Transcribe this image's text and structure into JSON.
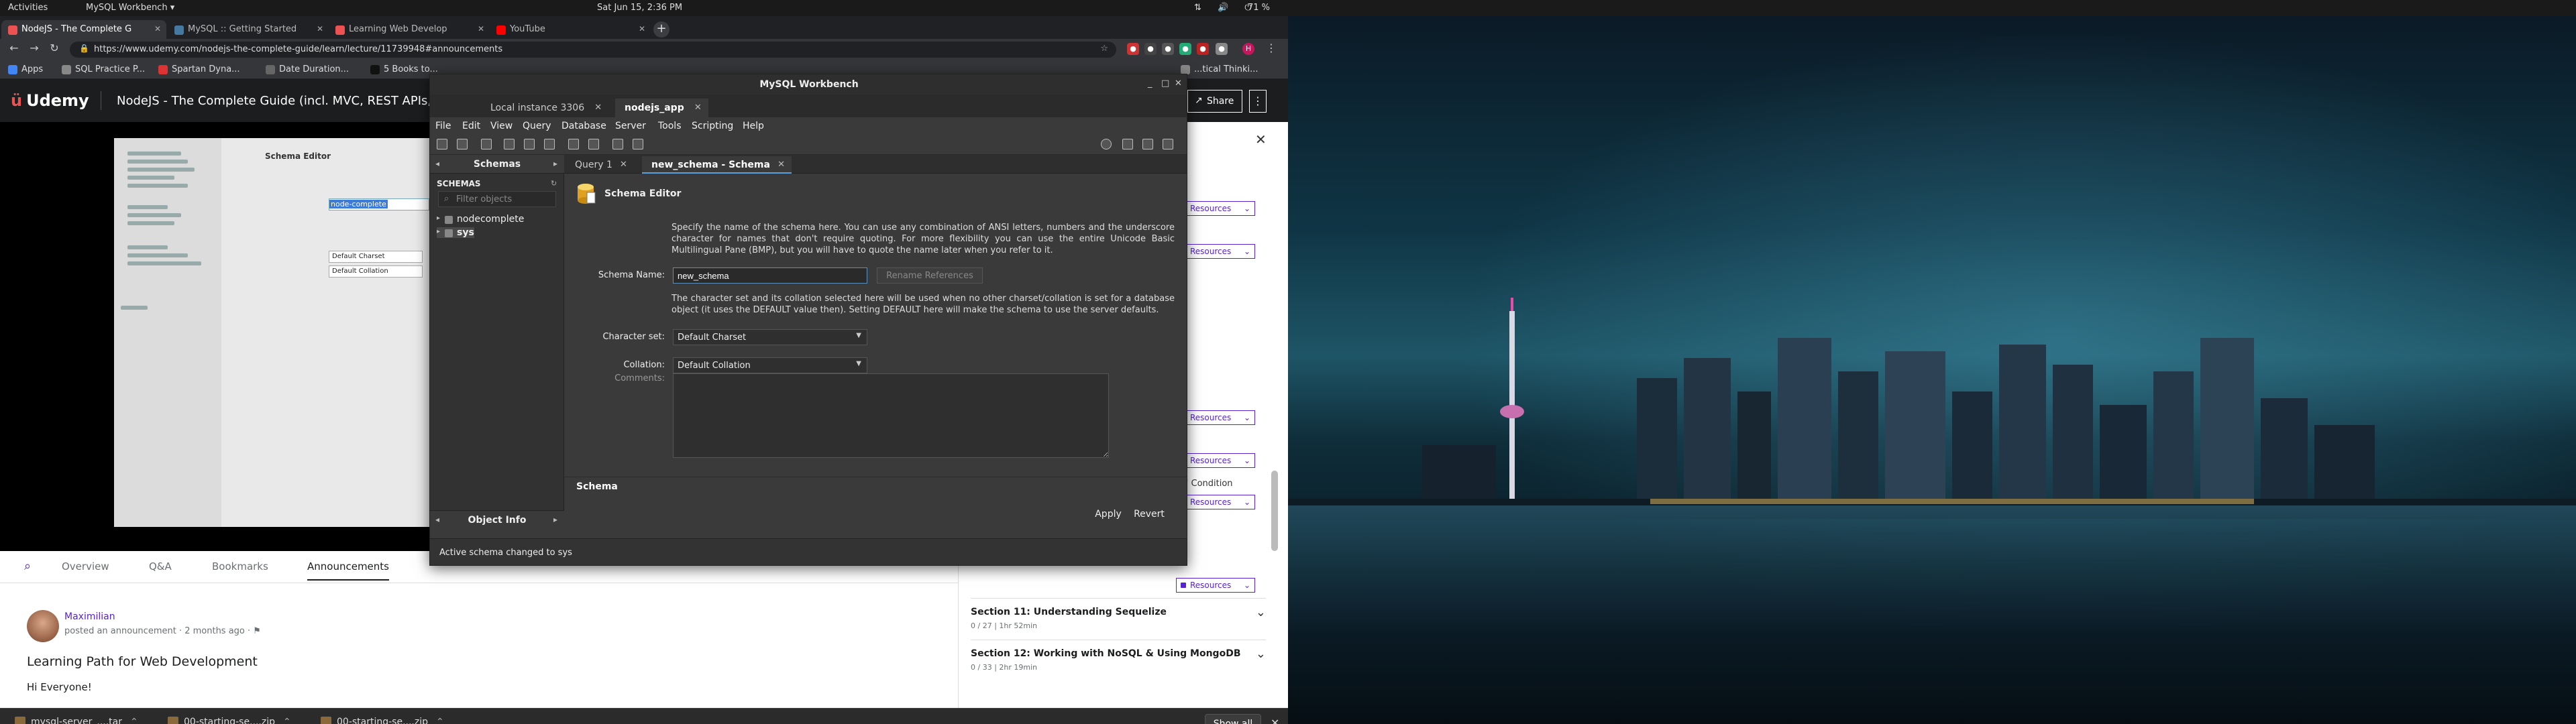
{
  "system_bar": {
    "activities": "Activities",
    "app_menu": "MySQL Workbench ▾",
    "clock": "Sat Jun 15,  2:36 PM",
    "battery": "71 %"
  },
  "browser": {
    "tabs": [
      {
        "label": "NodeJS - The Complete G",
        "active": true,
        "icon_color": "#ec5252"
      },
      {
        "label": "MySQL :: Getting Started",
        "active": false,
        "icon_color": "#4479a1"
      },
      {
        "label": "Learning Web Develop",
        "active": false,
        "icon_color": "#ec5252"
      },
      {
        "label": "YouTube",
        "active": false,
        "icon_color": "#ff0000"
      }
    ],
    "url": "https://www.udemy.com/nodejs-the-complete-guide/learn/lecture/11739948#announcements",
    "bookmarks": [
      {
        "label": "Apps",
        "icon_color": "#4285f4"
      },
      {
        "label": "SQL Practice P...",
        "icon_color": "#888888"
      },
      {
        "label": "Spartan Dyna...",
        "icon_color": "#d33"
      },
      {
        "label": "Date Duration...",
        "icon_color": "#666"
      },
      {
        "label": "5 Books to...",
        "icon_color": "#111"
      },
      {
        "label": "...tical Thinki...",
        "icon_color": "#888"
      }
    ]
  },
  "udemy": {
    "logo": "Udemy",
    "course_title": "NodeJS - The Complete Guide (incl. MVC, REST APIs, GraphQL)",
    "share_label": "Share",
    "more_label": "⋮",
    "tabs": [
      "Overview",
      "Q&A",
      "Bookmarks",
      "Announcements"
    ],
    "active_tab": "Announcements",
    "announcement": {
      "author": "Maximilian",
      "meta": "posted an announcement · 2 months ago ·",
      "title": "Learning Path for Web Development",
      "body": "Hi Everyone!"
    },
    "resources_label": "Resources",
    "condition_text": "...\" Condition",
    "sections": [
      {
        "title": "Section 11: Understanding Sequelize",
        "meta": "0 / 27 | 1hr 52min"
      },
      {
        "title": "Section 12: Working with NoSQL & Using MongoDB",
        "meta": "0 / 33 | 2hr 19min"
      }
    ],
    "video_screenshot": {
      "title": "Schema Editor",
      "input_value": "node-complete",
      "charset": "Default Charset",
      "collation": "Default Collation"
    }
  },
  "downloads": {
    "items": [
      "mysql-server_....tar",
      "00-starting-se....zip",
      "00-starting-se....zip"
    ],
    "show_all": "Show all"
  },
  "workbench": {
    "title": "MySQL Workbench",
    "connection_tabs": [
      {
        "label": "Local instance 3306",
        "active": false
      },
      {
        "label": "nodejs_app",
        "active": true
      }
    ],
    "menu": [
      "File",
      "Edit",
      "View",
      "Query",
      "Database",
      "Server",
      "Tools",
      "Scripting",
      "Help"
    ],
    "sidebar": {
      "header": "Schemas",
      "section_label": "SCHEMAS",
      "filter_placeholder": "Filter objects",
      "schemas": [
        {
          "name": "nodecomplete",
          "selected": false
        },
        {
          "name": "sys",
          "selected": true
        }
      ],
      "info_header": "Object Info"
    },
    "editor_tabs": [
      {
        "label": "Query 1",
        "active": false
      },
      {
        "label": "new_schema - Schema",
        "active": true
      }
    ],
    "schema_editor": {
      "title": "Schema Editor",
      "description": "Specify the name of the schema here. You can use any combination of ANSI letters, numbers and the underscore character for names that don't require quoting. For more flexibility you can use the entire Unicode Basic Multilingual Pane (BMP), but you will have to quote the name later when you refer to it.",
      "name_label": "Schema Name:",
      "name_value": "new_schema",
      "rename_button": "Rename References",
      "charset_description": "The character set and its collation selected here will be used when no other charset/collation is set for a database object (it uses the DEFAULT value then). Setting DEFAULT here will make the schema to use the server defaults.",
      "charset_label": "Character set:",
      "charset_value": "Default Charset",
      "collation_label": "Collation:",
      "collation_value": "Default Collation",
      "comments_label": "Comments:",
      "bottom_tab": "Schema",
      "apply": "Apply",
      "revert": "Revert"
    },
    "status": "Active schema changed to sys"
  }
}
